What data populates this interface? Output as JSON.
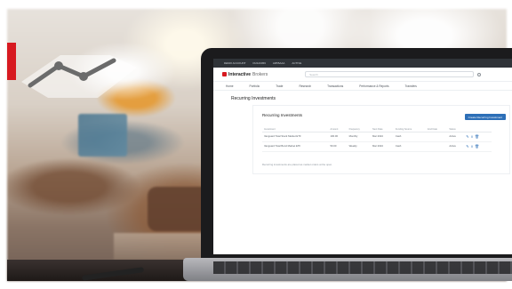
{
  "colors": {
    "brand_red": "#d71920",
    "accent_blue": "#2d6fb7",
    "topbar": "#2f3338"
  },
  "topbar": {
    "items": [
      "DEMO ACCOUNT",
      "DU123456",
      "AR55AAA",
      "ACTIVE"
    ]
  },
  "brand": {
    "bold": "Interactive",
    "light": "Brokers"
  },
  "search": {
    "placeholder": "Search"
  },
  "nav": {
    "items": [
      "Home",
      "Portfolio",
      "Trade",
      "Research",
      "Transactions",
      "Performance & Reports",
      "Transfers"
    ]
  },
  "page": {
    "title": "Recurring Investments"
  },
  "panel": {
    "title": "Recurring Investments",
    "create_button": "Create Recurring Investment",
    "columns": [
      "Investment",
      "Amount",
      "Frequency",
      "Next Date",
      "Funding Source",
      "End Date",
      "Status"
    ],
    "rows": [
      {
        "investment": "Vanguard Total Stock Market ETF",
        "amount": "100.00",
        "frequency": "Monthly",
        "next_date": "Mar 2024",
        "funding_source": "Cash",
        "end_date": "",
        "status": "Active"
      },
      {
        "investment": "Vanguard Total Bond Market ETF",
        "amount": "50.00",
        "frequency": "Weekly",
        "next_date": "Mar 2024",
        "funding_source": "Cash",
        "end_date": "",
        "status": "Active"
      }
    ],
    "footnote": "Recurring investments are placed as market orders at the open."
  }
}
